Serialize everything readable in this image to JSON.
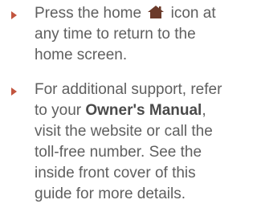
{
  "tips": [
    {
      "before_icon": "Press the home",
      "icon": "home-icon",
      "after_icon": "icon at any time to return to the home screen."
    },
    {
      "text_before": "For additional support, refer to your",
      "bold_text": "Owner's Manual",
      "text_after": ", visit the website or call the toll-free number. See the inside front cover of this guide for more details."
    }
  ],
  "colors": {
    "text": "#5f5f5f",
    "bullet": "#c2553f",
    "icon": "#6b3a2a"
  }
}
